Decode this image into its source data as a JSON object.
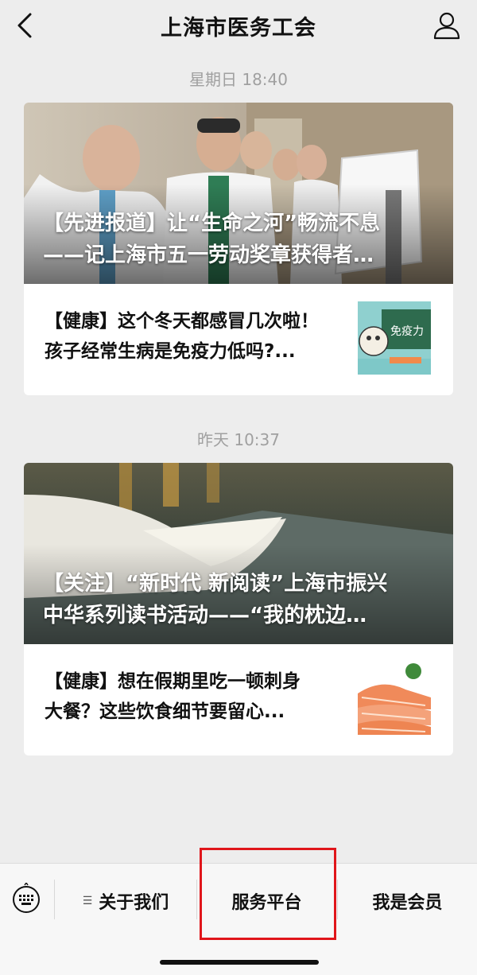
{
  "header": {
    "title": "上海市医务工会",
    "back_icon": "chevron-left-icon",
    "profile_icon": "person-icon"
  },
  "feed": [
    {
      "timestamp": "星期日 18:40",
      "cover_lines": [
        "【先进报道】让“生命之河”畅流不息",
        "——记上海市五一劳动奖章获得者…"
      ],
      "sub_lines": [
        "【健康】这个冬天都感冒几次啦！",
        "孩子经常生病是免疫力低吗?..."
      ],
      "thumb_text": "免疫力"
    },
    {
      "timestamp": "昨天 10:37",
      "cover_lines": [
        "【关注】“新时代 新阅读”上海市振兴",
        "中华系列读书活动——“我的枕边…"
      ],
      "sub_lines": [
        "【健康】想在假期里吃一顿刺身",
        "大餐？这些饮食细节要留心..."
      ]
    }
  ],
  "bottom_menu": {
    "keyboard_icon": "keyboard-icon",
    "items": [
      {
        "label": "关于我们",
        "icon": "menu-lines-icon"
      },
      {
        "label": "服务平台"
      },
      {
        "label": "我是会员"
      }
    ]
  },
  "colors": {
    "background": "#ededed",
    "highlight": "#e0161b"
  }
}
